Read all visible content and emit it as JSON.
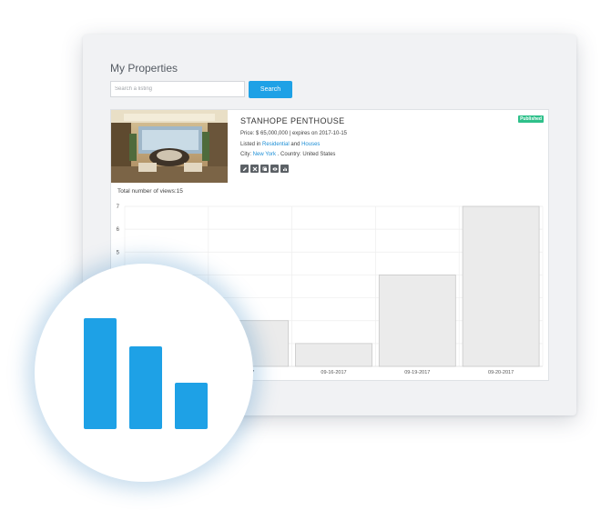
{
  "page": {
    "title": "My Properties"
  },
  "search": {
    "placeholder": "Search a listing",
    "button_label": "Search"
  },
  "listing": {
    "title": "STANHOPE PENTHOUSE",
    "status": "Published",
    "price_label": "Price:",
    "price": "$ 65,000,000",
    "separator": "|",
    "expires_text": "expires on 2017-10-15",
    "listed_in_prefix": "Listed in",
    "category_primary": "Residential",
    "and_text": "and",
    "category_secondary": "Houses",
    "city_label": "City:",
    "city": "New York",
    "country_text": ". Country: United States",
    "actions": [
      "edit-icon",
      "delete-icon",
      "copy-icon",
      "view-icon",
      "stats-icon"
    ]
  },
  "views": {
    "label": "Total number of views:15"
  },
  "colors": {
    "accent": "#1ea1e6",
    "published": "#2ec08a",
    "bar_fill": "#ebebeb",
    "bar_stroke": "#c8c8c8"
  },
  "chart_data": {
    "type": "bar",
    "categories": [
      "09-15-2017",
      "09-16-2017",
      "09-19-2017",
      "09-20-2017"
    ],
    "values": [
      2,
      1,
      4,
      7
    ],
    "y_tick_labels": [
      "7",
      "6",
      "5"
    ],
    "x_tick_labels": [
      "017",
      "09-16-2017",
      "09-19-2017",
      "09-20-2017"
    ],
    "ylim": [
      0,
      7
    ],
    "grid": true,
    "title": "",
    "xlabel": "",
    "ylabel": ""
  },
  "zoom_icon": {
    "name": "bar-chart-icon",
    "values": [
      3,
      2.25,
      1.25
    ]
  }
}
